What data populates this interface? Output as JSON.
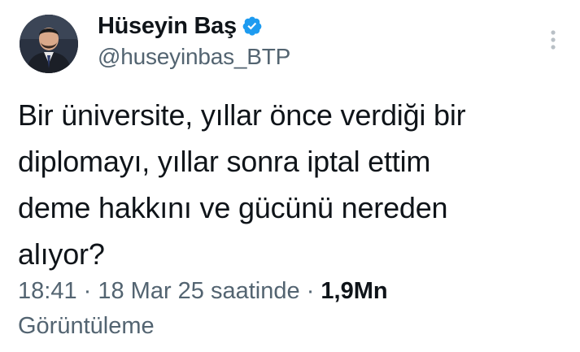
{
  "author": {
    "name": "Hüseyin Baş",
    "handle": "@huseyinbas_BTP",
    "verified": true
  },
  "tweet": {
    "lines": [
      "Bir üniversite, yıllar önce verdiği bir",
      "diplomayı, yıllar sonra iptal ettim",
      "deme hakkını ve gücünü nereden",
      "alıyor?"
    ]
  },
  "meta": {
    "time": "18:41",
    "separator": " · ",
    "date": "18 Mar 25 saatinde",
    "views_count": "1,9Mn",
    "views_label": "Görüntüleme"
  },
  "colors": {
    "verified": "#1d9bf0",
    "secondary_text": "#536471",
    "primary_text": "#0f1419"
  },
  "icons": {
    "verified": "verified-badge-icon",
    "more": "more-options-icon"
  }
}
